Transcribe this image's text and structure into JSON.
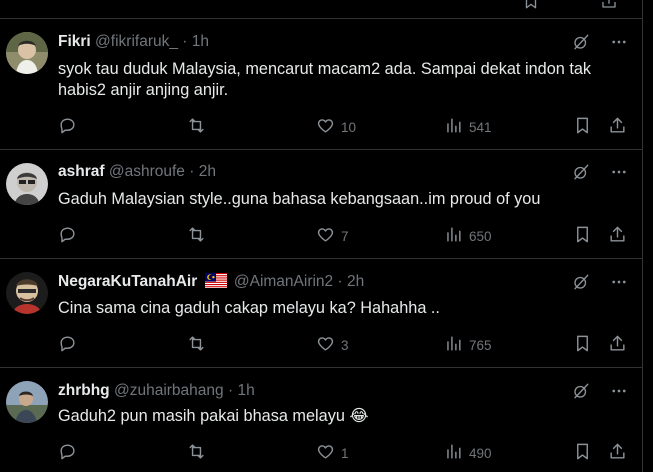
{
  "replies": [
    {
      "name": "Fikri",
      "handle": "@fikrifaruk_",
      "time": "1h",
      "text": "syok tau duduk Malaysia, mencarut macam2 ada. Sampai dekat indon tak habis2 anjir anjing anjir.",
      "likes": "10",
      "views": "541"
    },
    {
      "name": "ashraf",
      "handle": "@ashroufe",
      "time": "2h",
      "text": "Gaduh Malaysian style..guna bahasa kebangsaan..im proud of you",
      "likes": "7",
      "views": "650"
    },
    {
      "name": "NegaraKuTanahAir",
      "handle": "@AimanAirin2",
      "time": "2h",
      "text": "Cina sama cina gaduh cakap melayu ka? Hahahha ..",
      "likes": "3",
      "views": "765"
    },
    {
      "name": "zhrbhg",
      "handle": "@zuhairbahang",
      "time": "1h",
      "text": "Gaduh2 pun masih pakai bhasa melayu 😂",
      "likes": "1",
      "views": "490"
    }
  ],
  "separator": "·",
  "icons": {
    "grok": "grok-icon",
    "more": "more-icon",
    "reply": "reply-icon",
    "repost": "repost-icon",
    "like": "like-icon",
    "views": "views-icon",
    "bookmark": "bookmark-icon",
    "share": "share-icon"
  },
  "colors": {
    "background": "#000000",
    "text": "#e7e9ea",
    "muted": "#71767b",
    "border": "#2f3336"
  }
}
